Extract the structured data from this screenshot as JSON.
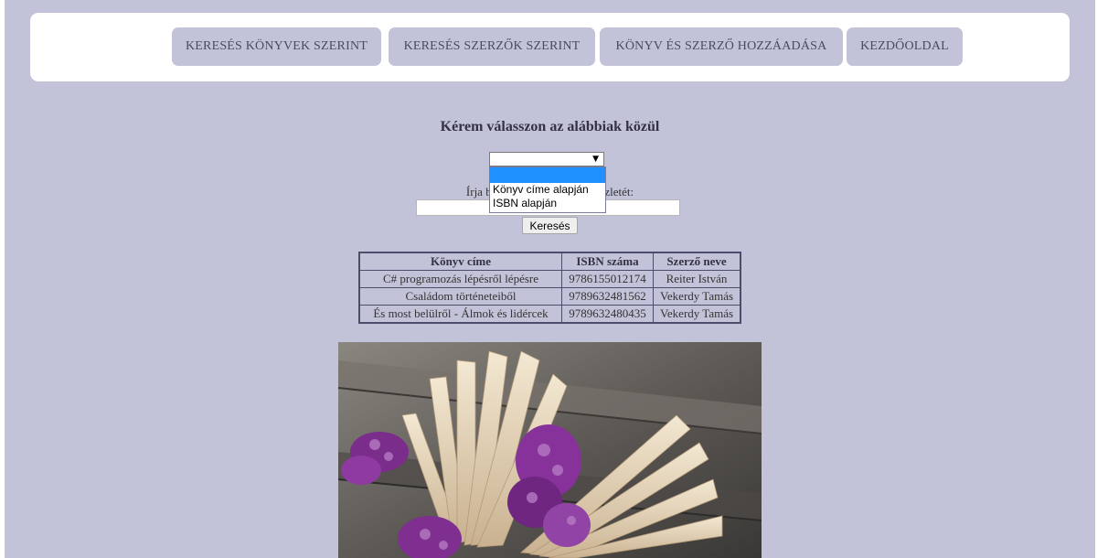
{
  "nav": {
    "items": [
      {
        "label": "KERESÉS KÖNYVEK SZERINT"
      },
      {
        "label": "KERESÉS SZERZŐK SZERINT"
      },
      {
        "label": "KÖNYV ÉS SZERZŐ HOZZÁADÁSA"
      },
      {
        "label": "KEZDŐOLDAL"
      }
    ]
  },
  "form": {
    "heading": "Kérem válasszon az alábbiak közül",
    "select_value": "",
    "options": [
      "",
      "Könyv címe alapján",
      "ISBN alapján"
    ],
    "prompt_left": "Írja be a",
    "prompt_right": "észletét:",
    "input_value": "",
    "search_label": "Keresés"
  },
  "table": {
    "headers": [
      "Könyv címe",
      "ISBN száma",
      "Szerző neve"
    ],
    "rows": [
      [
        "C# programozás lépésről lépésre",
        "9786155012174",
        "Reiter István"
      ],
      [
        "Családom történeteiből",
        "9789632481562",
        "Vekerdy Tamás"
      ],
      [
        "És most belülről - Álmok és lidércek",
        "9789632480435",
        "Vekerdy Tamás"
      ]
    ]
  },
  "colors": {
    "background": "#c2c2d8",
    "nav_button": "#c2c2d8",
    "dropdown_highlight": "#1e90ff"
  },
  "image": {
    "subject": "book-with-lilac-flowers-photo"
  }
}
